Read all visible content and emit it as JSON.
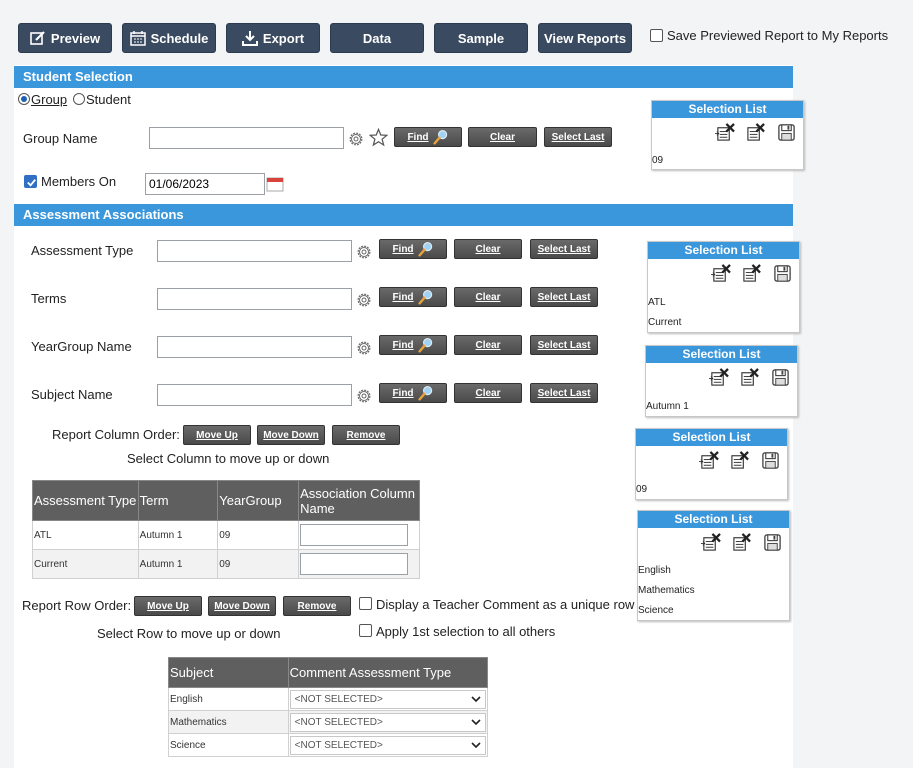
{
  "toolbar": {
    "preview": "Preview",
    "schedule": "Schedule",
    "export": "Export",
    "data": "Data",
    "sample": "Sample",
    "view_reports": "View Reports",
    "save_previewed": "Save Previewed Report to My Reports"
  },
  "student_selection": {
    "title": "Student Selection",
    "radio_group": "Group",
    "radio_student": "Student",
    "group_name_label": "Group Name",
    "group_name_value": "",
    "members_on_label": "Members On",
    "members_on_value": "01/06/2023",
    "members_on_checked": true
  },
  "buttons": {
    "find": "Find",
    "clear": "Clear",
    "select_last": "Select Last"
  },
  "assessment": {
    "title": "Assessment Associations",
    "fields": [
      {
        "label": "Assessment Type",
        "value": ""
      },
      {
        "label": "Terms",
        "value": ""
      },
      {
        "label": "YearGroup Name",
        "value": ""
      },
      {
        "label": "Subject Name",
        "value": ""
      }
    ],
    "column_order_label": "Report Column Order:",
    "move_up": "Move Up",
    "move_down": "Move Down",
    "remove": "Remove",
    "column_hint": "Select Column to move up or down",
    "table_headers": [
      "Assessment Type",
      "Term",
      "YearGroup",
      "Association Column Name"
    ],
    "table_rows": [
      [
        "ATL",
        "Autumn 1",
        "09"
      ],
      [
        "Current",
        "Autumn 1",
        "09"
      ]
    ],
    "row_order_label": "Report Row Order:",
    "row_hint": "Select Row to move up or down",
    "display_teacher_comment": "Display a Teacher Comment as a unique row",
    "apply_first": "Apply 1st selection to all others",
    "subject_headers": [
      "Subject",
      "Comment Assessment Type"
    ],
    "subject_rows": [
      {
        "subject": "English",
        "type": "<NOT SELECTED>"
      },
      {
        "subject": "Mathematics",
        "type": "<NOT SELECTED>"
      },
      {
        "subject": "Science",
        "type": "<NOT SELECTED>"
      }
    ]
  },
  "selection_lists": [
    {
      "title": "Selection List",
      "items": [
        "09"
      ]
    },
    {
      "title": "Selection List",
      "items": [
        "ATL",
        "Current"
      ]
    },
    {
      "title": "Selection List",
      "items": [
        "Autumn 1"
      ]
    },
    {
      "title": "Selection List",
      "items": [
        "09"
      ]
    },
    {
      "title": "Selection List",
      "items": [
        "English",
        "Mathematics",
        "Science"
      ]
    }
  ],
  "colors": {
    "toolbar": "#3a4a60",
    "section": "#3b97dc",
    "button": "#555555"
  }
}
